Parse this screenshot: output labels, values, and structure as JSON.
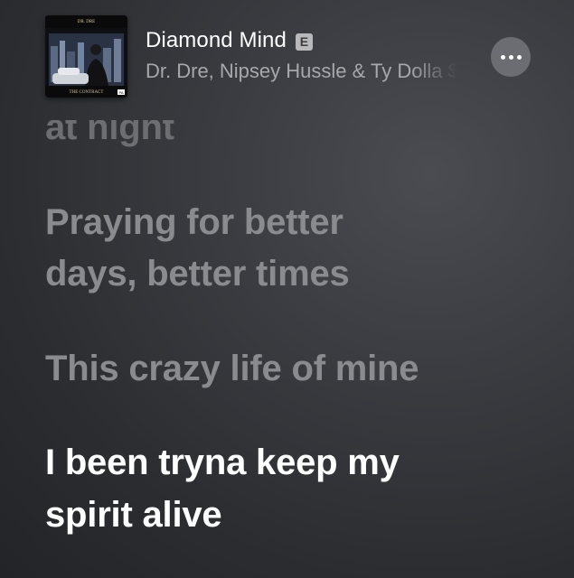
{
  "now_playing": {
    "title": "Diamond Mind",
    "explicit_badge": "E",
    "artists": "Dr. Dre, Nipsey Hussle & Ty Dolla $ign",
    "album_art": {
      "top_text": "DR. DRE",
      "bottom_text": "THE CONTRACT",
      "corner_badge": "PA",
      "icon": "album-cover"
    },
    "more_icon": "ellipsis-icon"
  },
  "lyrics": {
    "previous_partial": "at night",
    "previous_1": [
      "Praying for better",
      "days, better times"
    ],
    "previous_2": [
      "This crazy life of mine"
    ],
    "current": [
      "I been tryna keep my",
      "spirit alive"
    ]
  },
  "colors": {
    "active_lyric": "#ffffff",
    "inactive_lyric": "#8a8b8f",
    "subtitle": "#a7a8ab",
    "background": "#3a3c41"
  }
}
